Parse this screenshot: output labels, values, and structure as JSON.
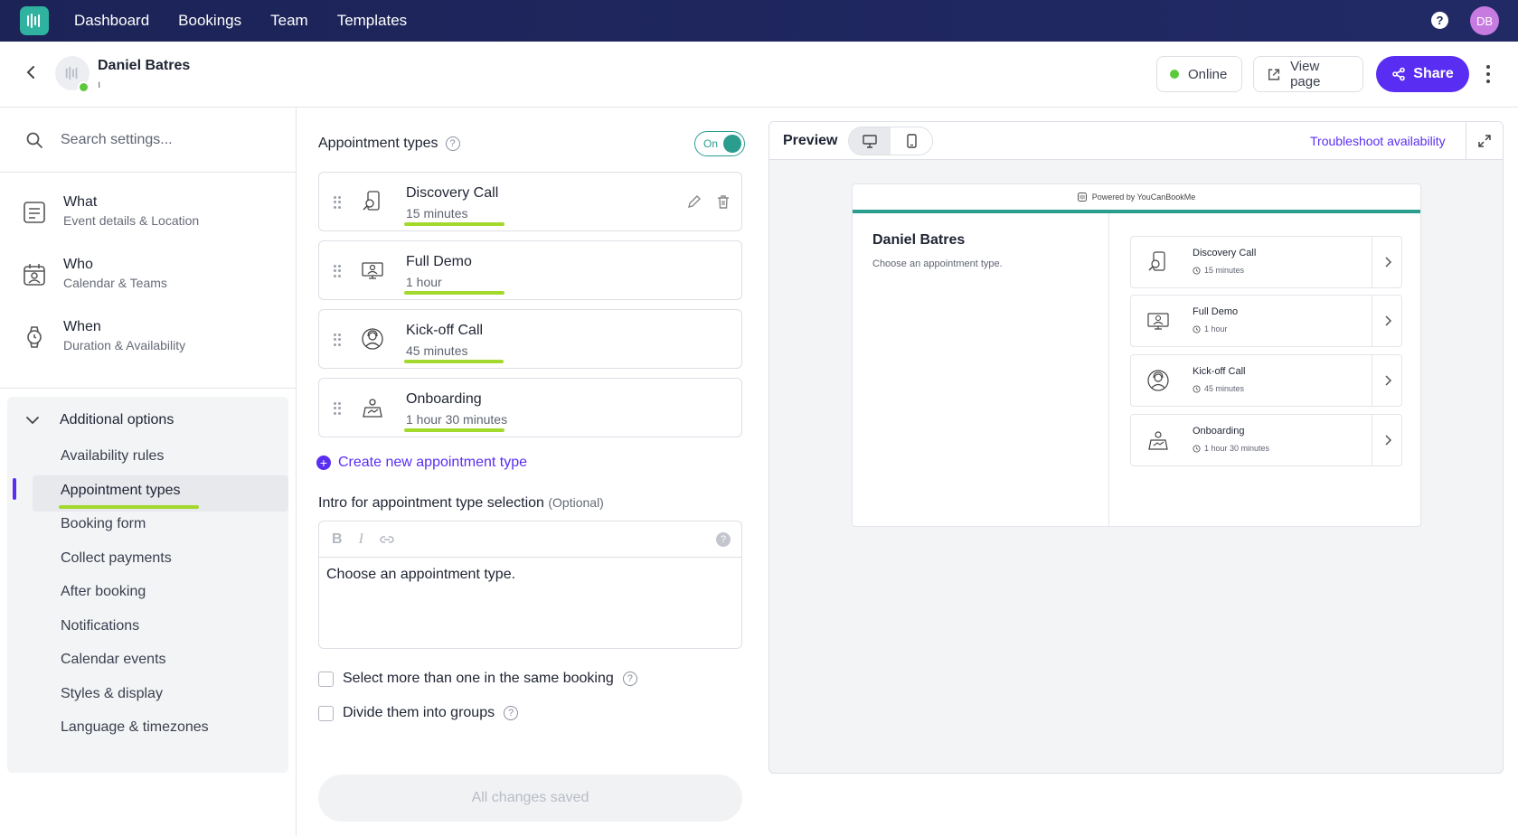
{
  "topnav": {
    "links": [
      "Dashboard",
      "Bookings",
      "Team",
      "Templates"
    ],
    "help_icon": "?",
    "user_initials": "DB"
  },
  "header": {
    "profile_name": "Daniel Batres",
    "profile_sub": "ı",
    "status_label": "Online",
    "view_page_label": "View page",
    "share_label": "Share"
  },
  "sidebar": {
    "search_placeholder": "Search settings...",
    "sections": [
      {
        "title": "What",
        "subtitle": "Event details & Location",
        "icon": "list-card-icon"
      },
      {
        "title": "Who",
        "subtitle": "Calendar & Teams",
        "icon": "calendar-person-icon"
      },
      {
        "title": "When",
        "subtitle": "Duration & Availability",
        "icon": "watch-icon"
      }
    ],
    "additional": {
      "title": "Additional options",
      "items": [
        "Availability rules",
        "Appointment types",
        "Booking form",
        "Collect payments",
        "After booking",
        "Notifications",
        "Calendar events",
        "Styles & display",
        "Language & timezones"
      ],
      "active_index": 1
    }
  },
  "main": {
    "heading": "Appointment types",
    "toggle_label": "On",
    "appointments": [
      {
        "name": "Discovery Call",
        "duration": "15 minutes",
        "icon": "phone-search-icon"
      },
      {
        "name": "Full Demo",
        "duration": "1 hour",
        "icon": "monitor-user-icon"
      },
      {
        "name": "Kick-off Call",
        "duration": "45 minutes",
        "icon": "headset-user-icon"
      },
      {
        "name": "Onboarding",
        "duration": "1 hour 30 minutes",
        "icon": "person-board-icon"
      }
    ],
    "create_label": "Create new appointment type",
    "intro_label": "Intro for appointment type selection",
    "intro_optional": "(Optional)",
    "editor_bold": "B",
    "editor_italic": "I",
    "editor_help": "?",
    "intro_text": "Choose an appointment type.",
    "check_multiple": "Select more than one in the same booking",
    "check_groups": "Divide them into groups",
    "save_label": "All changes saved"
  },
  "preview": {
    "title": "Preview",
    "troubleshoot_label": "Troubleshoot availability",
    "powered_by": "Powered by YouCanBookMe",
    "booking_name": "Daniel Batres",
    "booking_intro": "Choose an appointment type."
  },
  "colors": {
    "nav_bg": "#1c2357",
    "accent": "#5a2ef2",
    "teal": "#2a9d8f",
    "highlight": "#a3d82d",
    "online": "#5cc93b"
  }
}
